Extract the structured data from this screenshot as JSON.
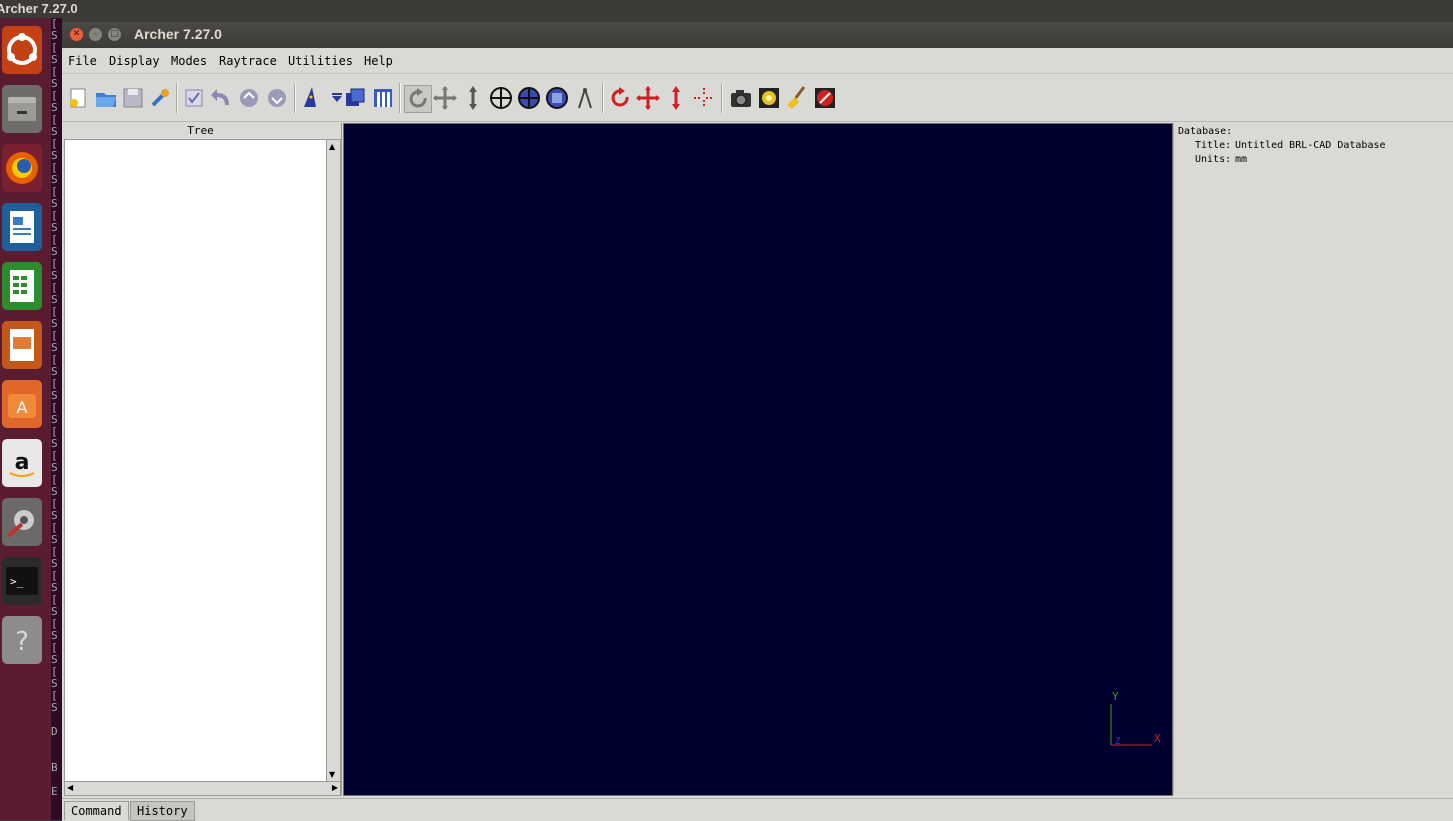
{
  "desktop": {
    "panel_title": "Archer 7.27.0"
  },
  "launcher": {
    "items": [
      "ubuntu-dash",
      "files",
      "firefox",
      "libreoffice-writer",
      "libreoffice-calc",
      "libreoffice-impress",
      "ubuntu-software",
      "amazon",
      "system-settings",
      "terminal",
      "help"
    ]
  },
  "terminal_strip": {
    "text": "[\nS\n[\nS\n[\nS\n[\nS\n[\nS\n[\nS\n[\nS\n[\nS\n[\nS\n[\nS\n[\nS\n[\nS\n[\nS\n[\nS\n[\nS\n[\nS\n[\nS\n[\nS\n[\nS\n[\nS\n[\nS\n[\nS\n[\nS\n[\nS\n[\nS\n[\nS\n[\nS\n[\nS\n[\nS\n\nD\n\n\nB\n\nE"
  },
  "window": {
    "title": "Archer 7.27.0"
  },
  "menu": {
    "file": "File",
    "display": "Display",
    "modes": "Modes",
    "raytrace": "Raytrace",
    "utilities": "Utilities",
    "help": "Help"
  },
  "tree": {
    "header": "Tree"
  },
  "properties": {
    "database_label": "Database:",
    "title_label": "Title:",
    "title_value": "Untitled BRL-CAD Database",
    "units_label": "Units:",
    "units_value": "mm"
  },
  "axes": {
    "y": "Y",
    "x": "X",
    "z": "Z",
    "x_color": "#cc2222",
    "y_color": "#22aa22",
    "z_color": "#2244cc"
  },
  "tabs": {
    "command": "Command",
    "history": "History"
  },
  "colors": {
    "viewport_bg": "#000030",
    "launcher_bg": "#5a1c31"
  }
}
